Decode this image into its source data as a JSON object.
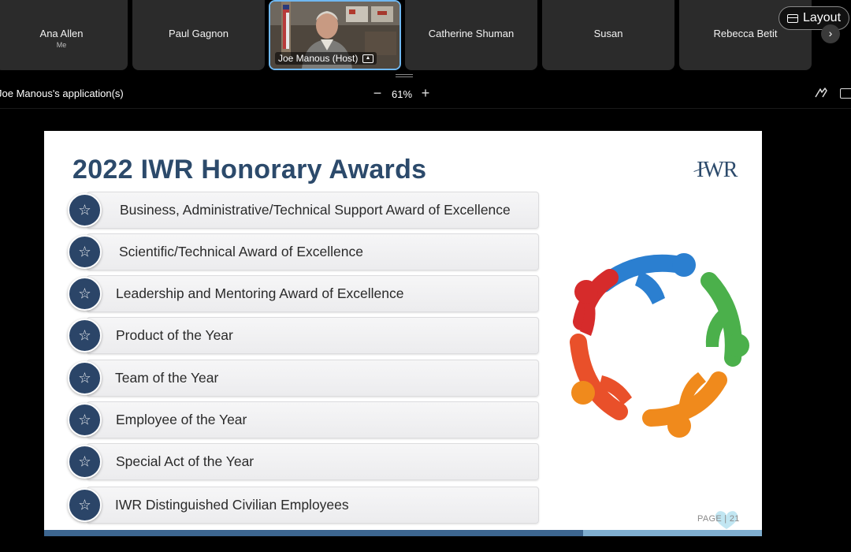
{
  "participants": [
    {
      "name": "Ana Allen",
      "sub": "Me"
    },
    {
      "name": "Paul Gagnon"
    },
    {
      "name": "Joe Manous (Host)",
      "video": true
    },
    {
      "name": "Catherine Shuman"
    },
    {
      "name": "Susan"
    },
    {
      "name": "Rebecca Betit"
    }
  ],
  "layout_button": {
    "label": "Layout",
    "icon": "layout-icon"
  },
  "next_icon": "›",
  "sharebar": {
    "title": "Joe Manous's application(s)",
    "zoom_minus": "−",
    "zoom_value": "61%",
    "zoom_plus": "+"
  },
  "slide": {
    "title": "2022 IWR Honorary Awards",
    "logo": "IWR",
    "awards": [
      "Business, Administrative/Technical Support Award of Excellence",
      "Scientific/Technical Award of Excellence",
      "Leadership and Mentoring Award of Excellence",
      "Product of the Year",
      "Team of the Year",
      "Employee of the Year",
      "Special Act of the Year",
      "IWR Distinguished Civilian Employees"
    ],
    "star_glyph": "✮",
    "page_label": "PAGE | 21",
    "colors": {
      "title": "#2c4a6b",
      "badge": "#2b4568",
      "footer": "#3d6690",
      "team": [
        "#2b7fd0",
        "#4bb04b",
        "#f08a1c",
        "#e04a2a",
        "#d62b2b"
      ]
    }
  }
}
